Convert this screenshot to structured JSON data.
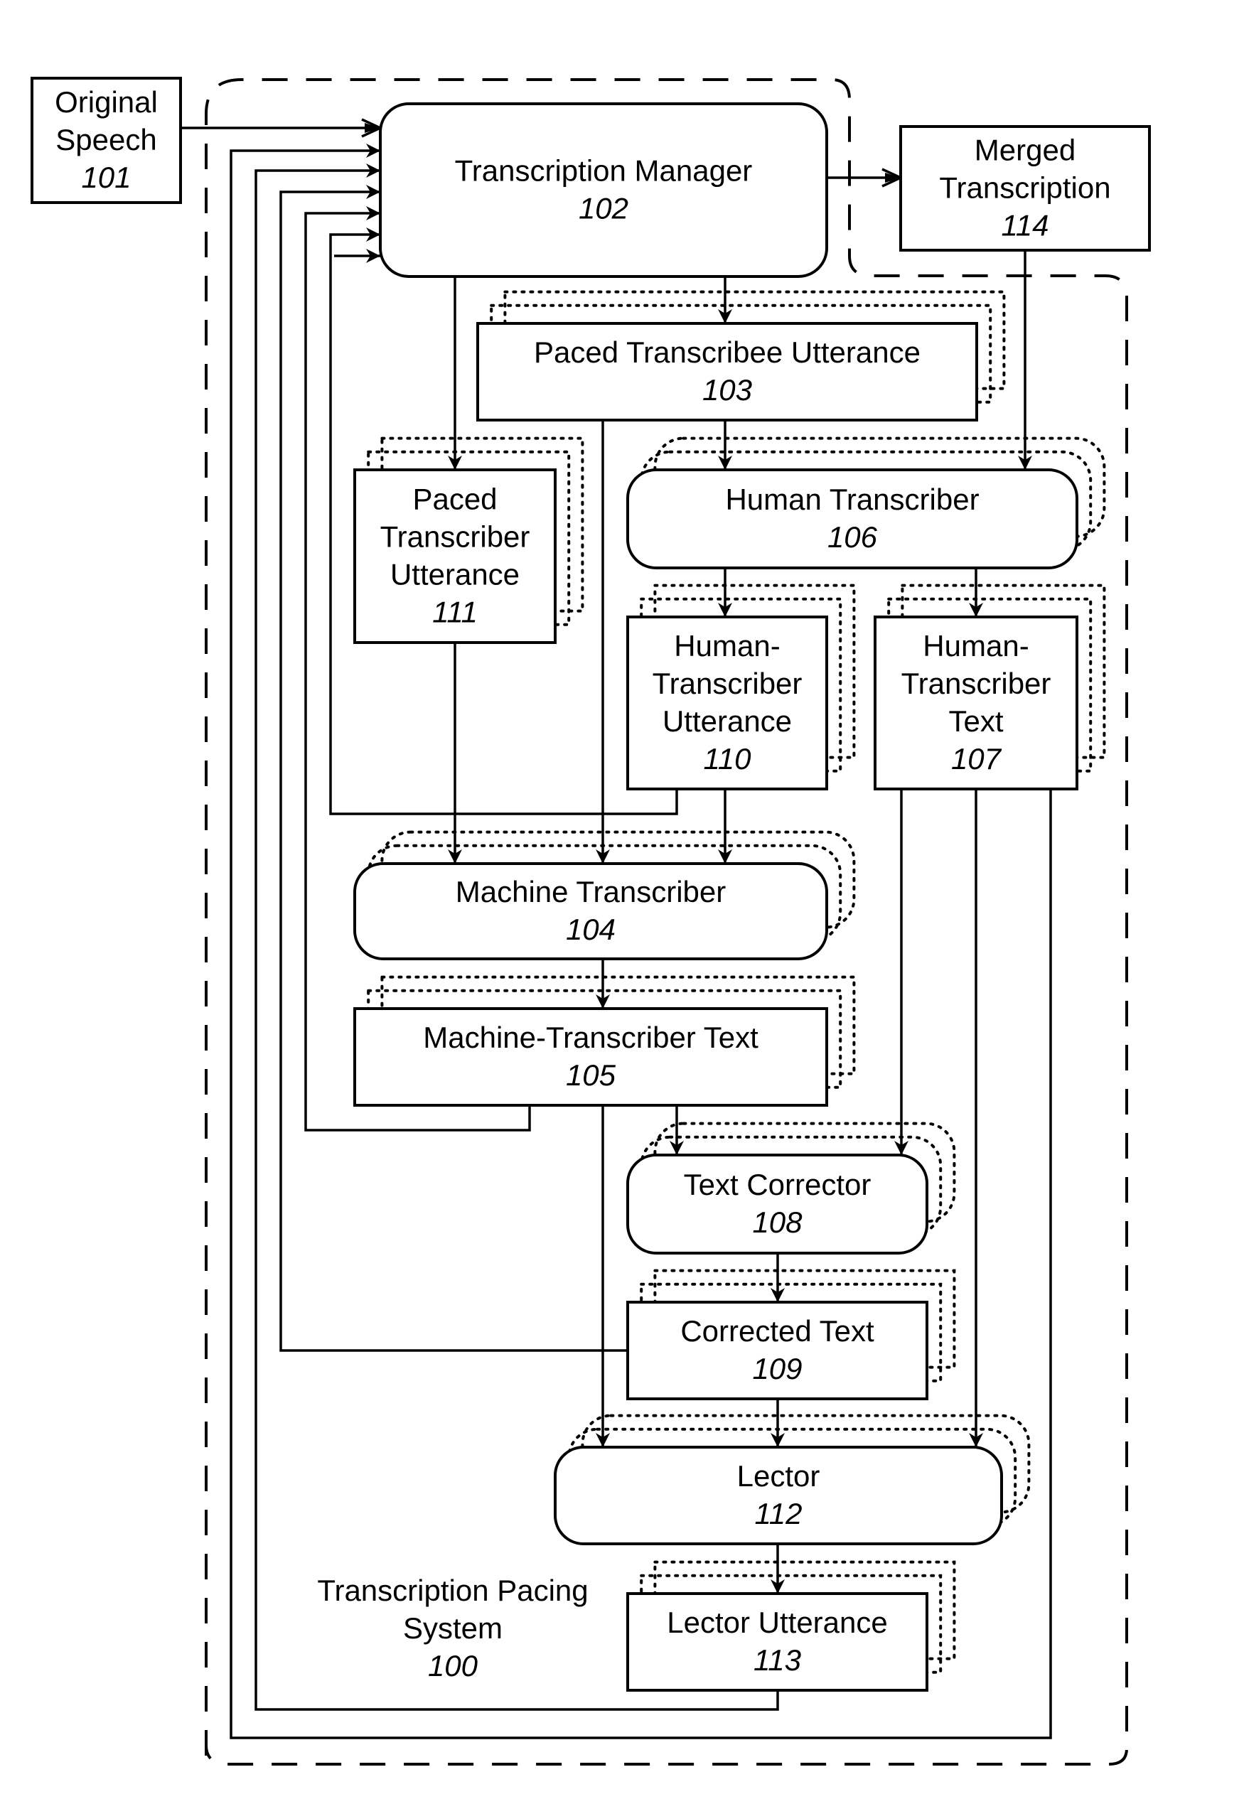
{
  "figure": {
    "system_label": [
      "Transcription Pacing",
      "System"
    ],
    "system_number": "100",
    "nodes": {
      "original_speech": {
        "lines": [
          "Original",
          "Speech"
        ],
        "number": "101"
      },
      "transcription_manager": {
        "lines": [
          "Transcription Manager"
        ],
        "number": "102"
      },
      "paced_transcribee_utterance": {
        "lines": [
          "Paced Transcribee Utterance"
        ],
        "number": "103"
      },
      "machine_transcriber": {
        "lines": [
          "Machine Transcriber"
        ],
        "number": "104"
      },
      "machine_transcriber_text": {
        "lines": [
          "Machine-Transcriber Text"
        ],
        "number": "105"
      },
      "human_transcriber": {
        "lines": [
          "Human Transcriber"
        ],
        "number": "106"
      },
      "human_transcriber_text": {
        "lines": [
          "Human-",
          "Transcriber",
          "Text"
        ],
        "number": "107"
      },
      "text_corrector": {
        "lines": [
          "Text Corrector"
        ],
        "number": "108"
      },
      "corrected_text": {
        "lines": [
          "Corrected Text"
        ],
        "number": "109"
      },
      "human_transcriber_utterance": {
        "lines": [
          "Human-",
          "Transcriber",
          "Utterance"
        ],
        "number": "110"
      },
      "paced_transcriber_utterance": {
        "lines": [
          "Paced",
          "Transcriber",
          "Utterance"
        ],
        "number": "111"
      },
      "lector": {
        "lines": [
          "Lector"
        ],
        "number": "112"
      },
      "lector_utterance": {
        "lines": [
          "Lector Utterance"
        ],
        "number": "113"
      },
      "merged_transcription": {
        "lines": [
          "Merged",
          "Transcription"
        ],
        "number": "114"
      }
    }
  }
}
